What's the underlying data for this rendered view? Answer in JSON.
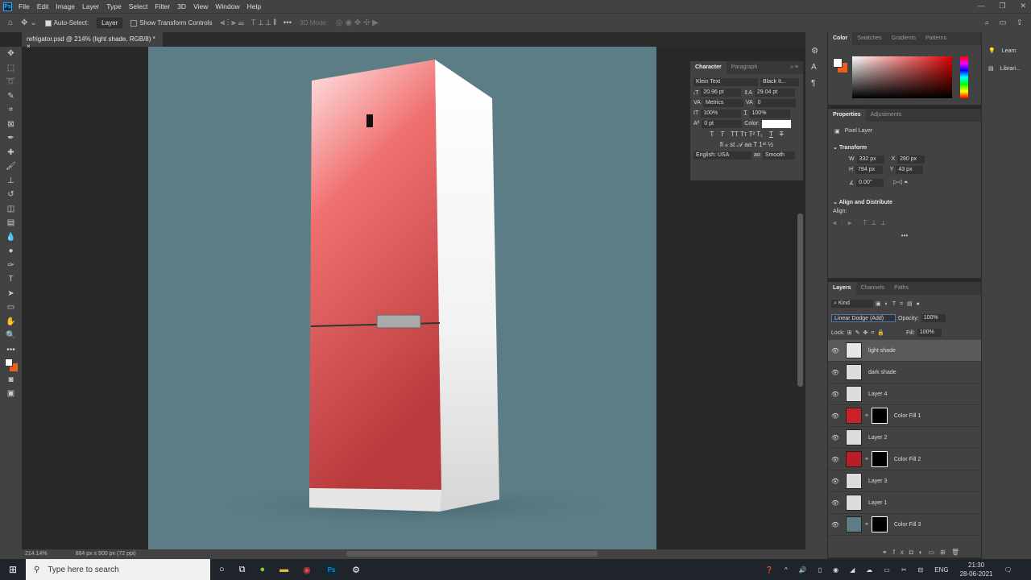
{
  "app": {
    "logo": "Ps",
    "menu": [
      "File",
      "Edit",
      "Image",
      "Layer",
      "Type",
      "Select",
      "Filter",
      "3D",
      "View",
      "Window",
      "Help"
    ]
  },
  "options": {
    "auto_select_label": "Auto-Select:",
    "auto_select_value": "Layer",
    "show_transform_label": "Show Transform Controls",
    "mode_3d": "3D Mode:"
  },
  "document": {
    "tab_title": "refrigator.psd @ 214% (light shade, RGB/8) *",
    "zoom": "214.14%",
    "size": "884 px x 900 px (72 ppi)"
  },
  "character": {
    "tabs": [
      "Character",
      "Paragraph"
    ],
    "font": "Klein Text",
    "style": "Black It...",
    "size": "20.96 pt",
    "leading": "29.04 pt",
    "kerning": "Metrics",
    "tracking": "0",
    "vscale": "100%",
    "hscale": "100%",
    "baseline": "0 pt",
    "color_label": "Color:",
    "language": "English: USA",
    "aa_label": "aɑ",
    "antialias": "Smooth",
    "text_color": "#ffffff"
  },
  "color_panel": {
    "tabs": [
      "Color",
      "Swatches",
      "Gradients",
      "Patterns"
    ],
    "foreground": "#ffffff",
    "background": "#e8601c"
  },
  "properties": {
    "tabs": [
      "Properties",
      "Adjustments"
    ],
    "kind": "Pixel Layer",
    "transform_label": "Transform",
    "w": "332 px",
    "h": "784 px",
    "x": "280 px",
    "y": "43 px",
    "angle": "0.00°",
    "align_label": "Align and Distribute",
    "align_sub": "Align:"
  },
  "layers_panel": {
    "tabs": [
      "Layers",
      "Channels",
      "Paths"
    ],
    "filter": "Kind",
    "blend_mode": "Linear Dodge (Add)",
    "opacity_label": "Opacity:",
    "opacity": "100%",
    "lock_label": "Lock:",
    "fill_label": "Fill:",
    "fill": "100%",
    "layers": [
      {
        "name": "light shade",
        "selected": true,
        "thumb": "#e6e6e6",
        "mask": false
      },
      {
        "name": "dark shade",
        "thumb": "#dddddd",
        "mask": false
      },
      {
        "name": "Layer 4",
        "thumb": "#dddddd",
        "mask": false
      },
      {
        "name": "Color Fill 1",
        "thumb": "#c8222a",
        "mask": true
      },
      {
        "name": "Layer 2",
        "thumb": "#dddddd",
        "mask": false
      },
      {
        "name": "Color Fill 2",
        "thumb": "#b81e24",
        "mask": true
      },
      {
        "name": "Layer 3",
        "thumb": "#dddddd",
        "mask": false
      },
      {
        "name": "Layer 1",
        "thumb": "#dddddd",
        "mask": false
      },
      {
        "name": "Color Fill 3",
        "thumb": "#5d7d86",
        "mask": true
      }
    ]
  },
  "right_strip": [
    "Learn",
    "Librari..."
  ],
  "taskbar": {
    "search_placeholder": "Type here to search",
    "lang": "ENG",
    "time": "21:30",
    "date": "28-06-2021"
  },
  "canvas_bg": "#5d7d86"
}
